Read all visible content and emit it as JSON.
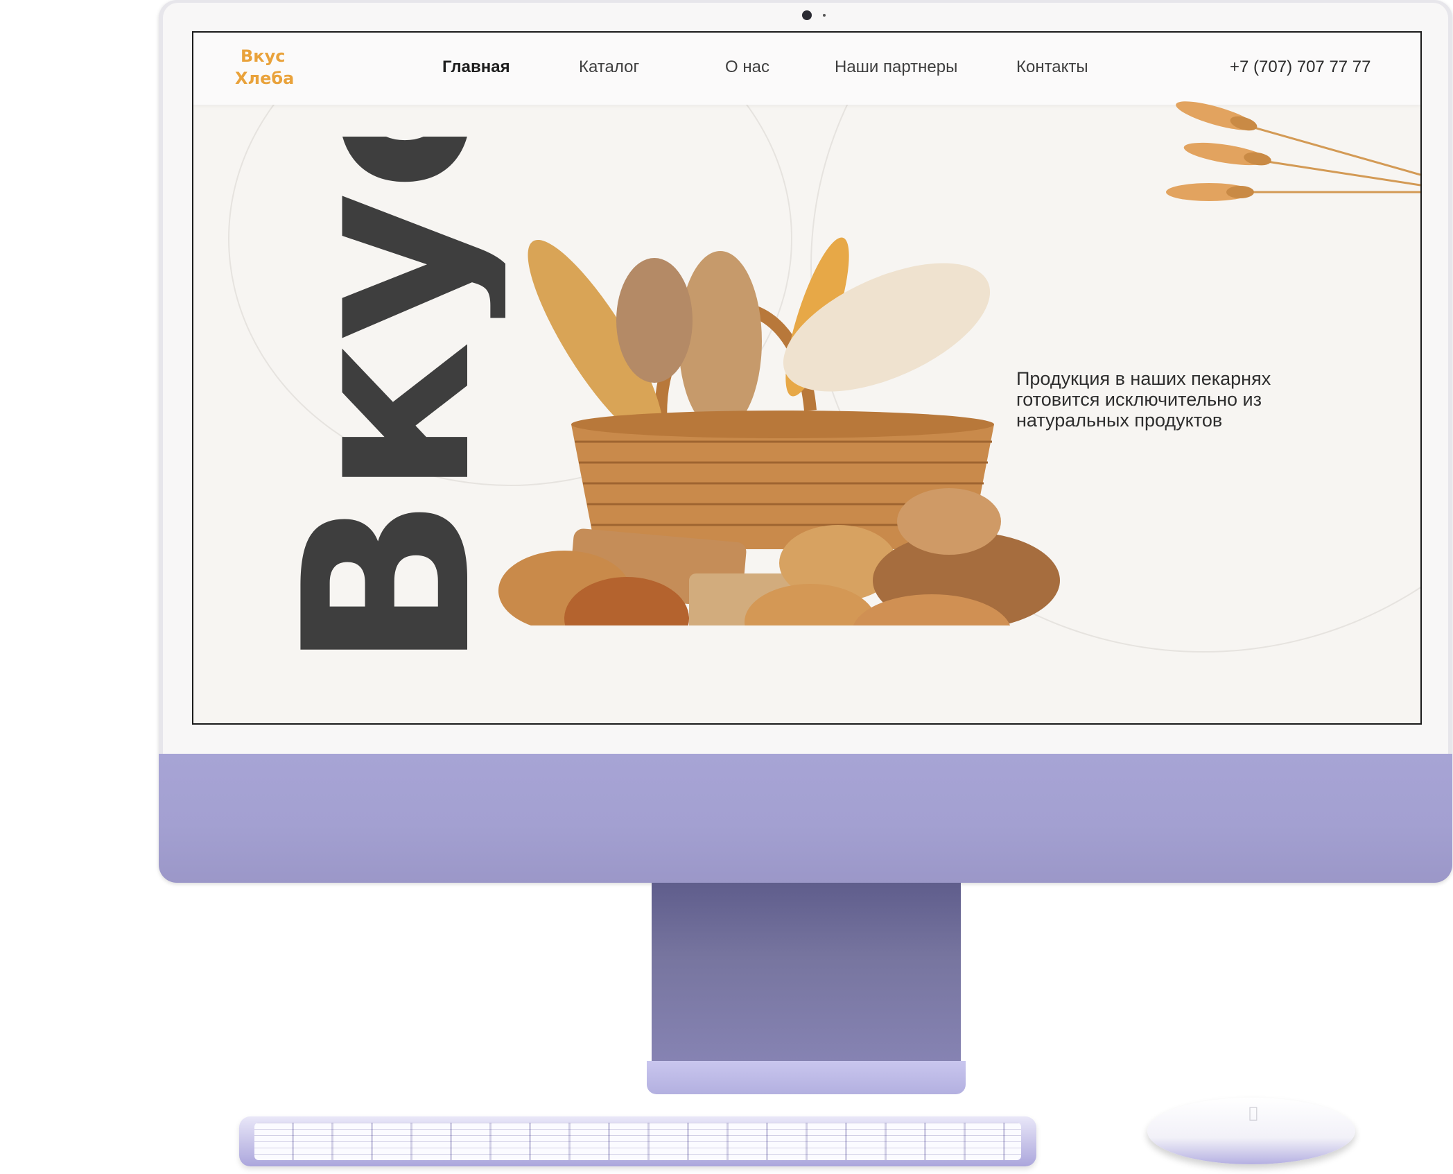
{
  "site": {
    "logo_line1": "Вкус",
    "logo_line2": "Хлеба",
    "nav": [
      {
        "label": "Главная",
        "active": true
      },
      {
        "label": "Каталог",
        "active": false
      },
      {
        "label": "О нас",
        "active": false
      },
      {
        "label": "Наши партнеры",
        "active": false
      },
      {
        "label": "Контакты",
        "active": false
      }
    ],
    "phone": "+7 (707) 707 77 77",
    "hero": {
      "big_word": "Вкус",
      "tagline_line1": "Продукция в наших пекарнях",
      "tagline_line2": "готовится исключительно из",
      "tagline_line3": "натуральных продуктов",
      "image": "bread-basket-image",
      "decoration": "wheat-ears-icon"
    }
  },
  "device": {
    "type": "desktop-monitor",
    "accent_color": "#a5a2d4",
    "logo_color": "#e9a23b"
  }
}
